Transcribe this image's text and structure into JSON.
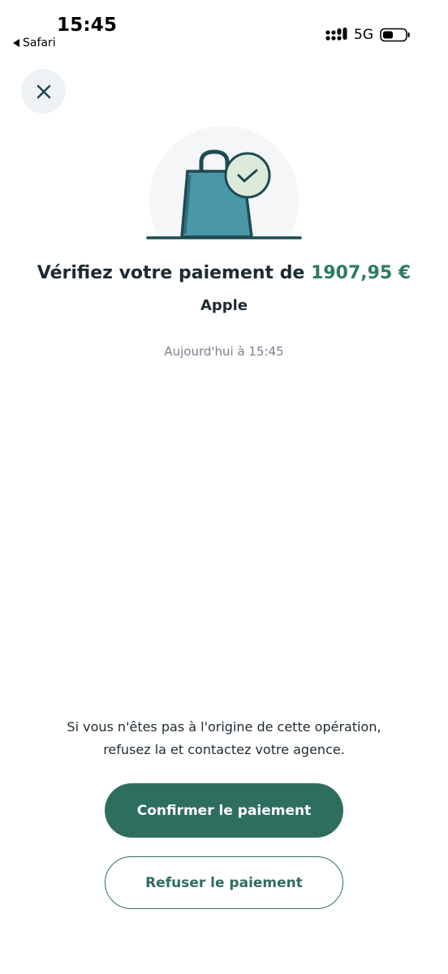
{
  "status_bar": {
    "time": "15:45",
    "back_label": "Safari",
    "network": "5G",
    "icons": [
      "back-arrow-icon",
      "signal-icon",
      "battery-icon"
    ]
  },
  "header": {
    "close_icon": "close-icon"
  },
  "illustration": {
    "icon": "shopping-bag-check-icon",
    "colors": {
      "bag": "#4a97a8",
      "bag_dark": "#1f4a52",
      "check_bg": "#dcebd9",
      "circle_bg": "#f4f6f8"
    }
  },
  "payment": {
    "title_prefix": "Vérifiez votre paiement de",
    "amount": "1907,95 €",
    "merchant": "Apple",
    "date": "Aujourd'hui à 15:45"
  },
  "footer": {
    "notice_line1": "Si vous n'êtes pas à l'origine de cette opération,",
    "notice_line2": "refusez la et contactez votre agence.",
    "confirm_label": "Confirmer le paiement",
    "refuse_label": "Refuser le paiement"
  },
  "colors": {
    "accent": "#2e6e5f",
    "amount": "#2c7a64",
    "text": "#1d2b33",
    "muted": "#7c8190"
  }
}
